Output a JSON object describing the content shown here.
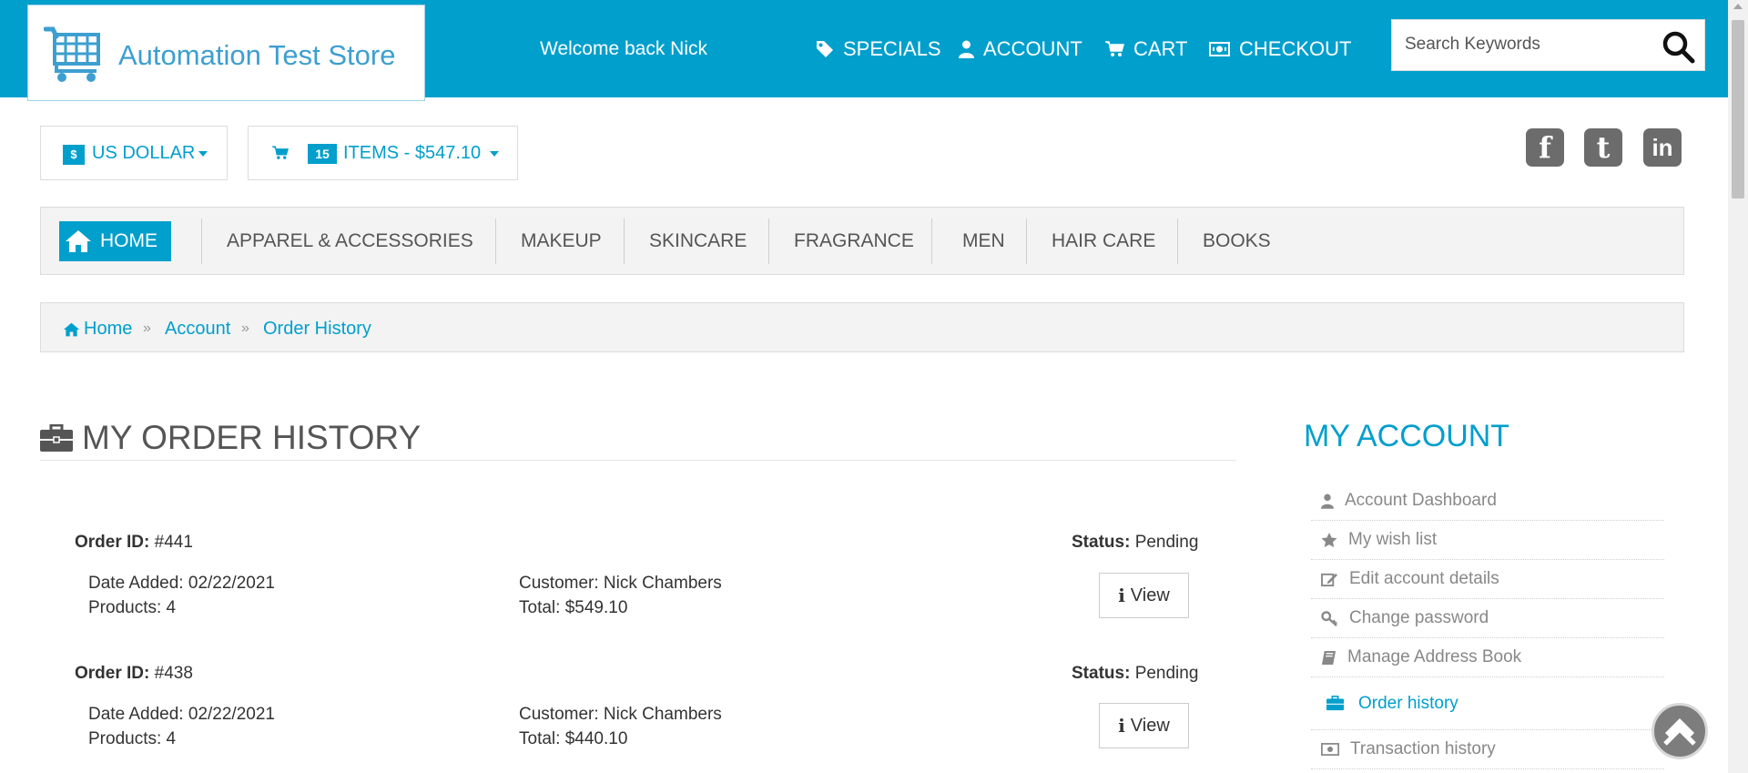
{
  "header": {
    "logo_text": "Automation Test Store",
    "welcome": "Welcome back Nick",
    "nav": [
      {
        "label": "SPECIALS",
        "icon": "tag-icon"
      },
      {
        "label": "ACCOUNT",
        "icon": "user-icon"
      },
      {
        "label": "CART",
        "icon": "cart-icon"
      },
      {
        "label": "CHECKOUT",
        "icon": "money-icon"
      }
    ],
    "search_placeholder": "Search Keywords"
  },
  "currency": {
    "symbol": "$",
    "label": "US DOLLAR"
  },
  "cart": {
    "count": "15",
    "label": "ITEMS - $547.10"
  },
  "social": [
    {
      "glyph": "f",
      "icon": "facebook-icon"
    },
    {
      "glyph": "t",
      "icon": "twitter-icon"
    },
    {
      "glyph": "in",
      "icon": "linkedin-icon"
    }
  ],
  "categories": {
    "home": "HOME",
    "items": [
      "APPAREL & ACCESSORIES",
      "MAKEUP",
      "SKINCARE",
      "FRAGRANCE",
      "MEN",
      "HAIR CARE",
      "BOOKS"
    ]
  },
  "breadcrumb": {
    "items": [
      "Home",
      "Account",
      "Order History"
    ],
    "separator": "»"
  },
  "main": {
    "title": "MY ORDER HISTORY",
    "labels": {
      "order_id": "Order ID:",
      "status": "Status:",
      "date_added": "Date Added:",
      "products": "Products:",
      "customer": "Customer:",
      "total": "Total:",
      "view": "View"
    },
    "orders": [
      {
        "id": "#441",
        "status": "Pending",
        "date_added": "02/22/2021",
        "products": "4",
        "customer": "Nick Chambers",
        "total": "$549.10"
      },
      {
        "id": "#438",
        "status": "Pending",
        "date_added": "02/22/2021",
        "products": "4",
        "customer": "Nick Chambers",
        "total": "$440.10"
      }
    ]
  },
  "sidebar": {
    "title": "MY ACCOUNT",
    "items": [
      {
        "label": "Account Dashboard",
        "icon": "user-icon"
      },
      {
        "label": "My wish list",
        "icon": "star-icon"
      },
      {
        "label": "Edit account details",
        "icon": "edit-icon"
      },
      {
        "label": "Change password",
        "icon": "key-icon"
      },
      {
        "label": "Manage Address Book",
        "icon": "book-icon"
      },
      {
        "label": "Order history",
        "icon": "briefcase-icon",
        "active": true
      },
      {
        "label": "Transaction history",
        "icon": "money-icon"
      }
    ]
  },
  "colors": {
    "accent": "#009fcc",
    "muted": "#888888",
    "text": "#333333",
    "panel": "#f3f3f3"
  }
}
